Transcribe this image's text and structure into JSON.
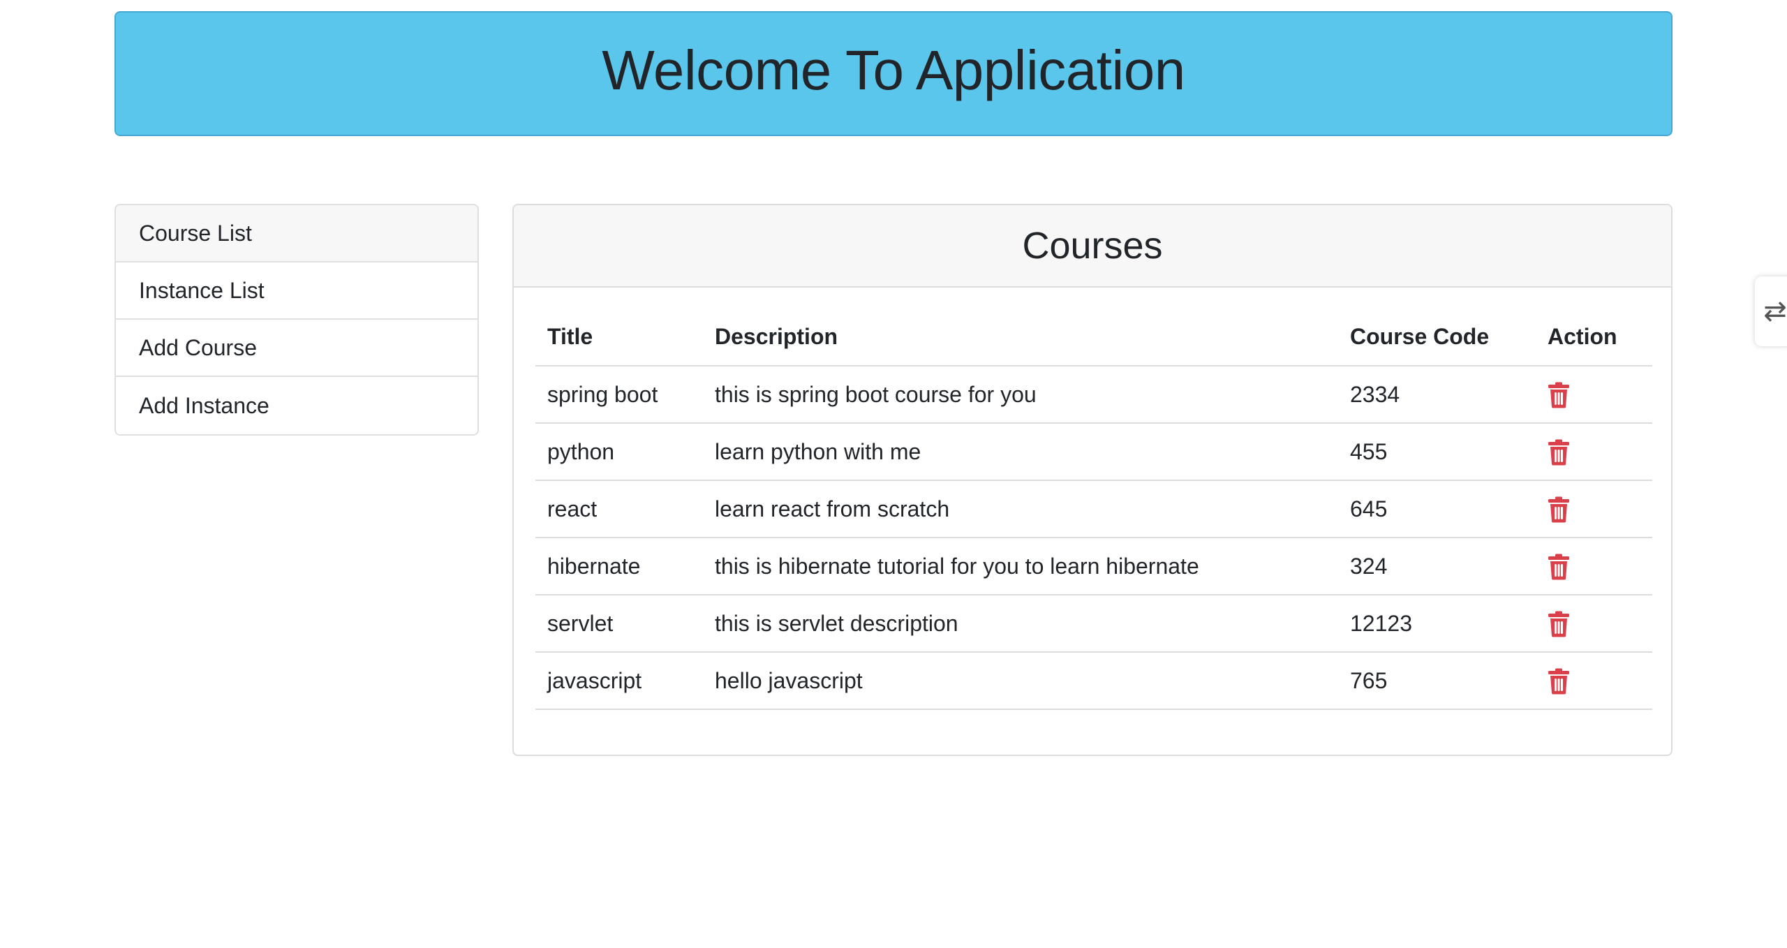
{
  "header": {
    "title": "Welcome To Application"
  },
  "sidebar": {
    "items": [
      {
        "label": "Course List"
      },
      {
        "label": "Instance List"
      },
      {
        "label": "Add Course"
      },
      {
        "label": "Add Instance"
      }
    ]
  },
  "courses": {
    "title": "Courses",
    "columns": {
      "title": "Title",
      "description": "Description",
      "code": "Course Code",
      "action": "Action"
    },
    "rows": [
      {
        "title": "spring boot",
        "description": "this is spring boot course for you",
        "code": "2334"
      },
      {
        "title": "python",
        "description": "learn python with me",
        "code": "455"
      },
      {
        "title": "react",
        "description": "learn react from scratch",
        "code": "645"
      },
      {
        "title": "hibernate",
        "description": "this is hibernate tutorial for you to learn hibernate",
        "code": "324"
      },
      {
        "title": "servlet",
        "description": "this is servlet description",
        "code": "12123"
      },
      {
        "title": "javascript",
        "description": "hello javascript",
        "code": "765"
      }
    ]
  },
  "right_tab": {
    "icon": "extension-handle-icon",
    "glyph": "⇄"
  },
  "colors": {
    "header_bg": "#5bc6ec",
    "delete_icon": "#d9404a"
  }
}
